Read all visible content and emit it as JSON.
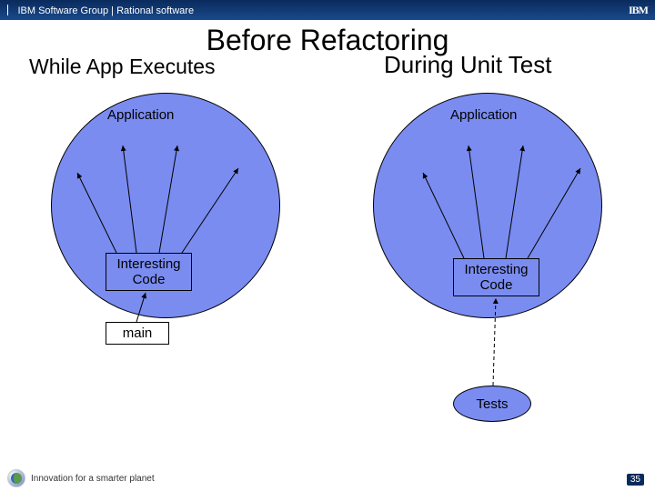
{
  "header": {
    "text": "IBM Software Group | Rational software",
    "logo": "IBM"
  },
  "title": "Before Refactoring",
  "subtitles": {
    "left": "While App Executes",
    "right": "During Unit Test"
  },
  "labels": {
    "app_left": "Application",
    "app_right": "Application",
    "code_left": "Interesting Code",
    "code_right": "Interesting Code",
    "main": "main",
    "tests": "Tests"
  },
  "footer": {
    "text": "Innovation for a smarter planet",
    "page": "35"
  }
}
